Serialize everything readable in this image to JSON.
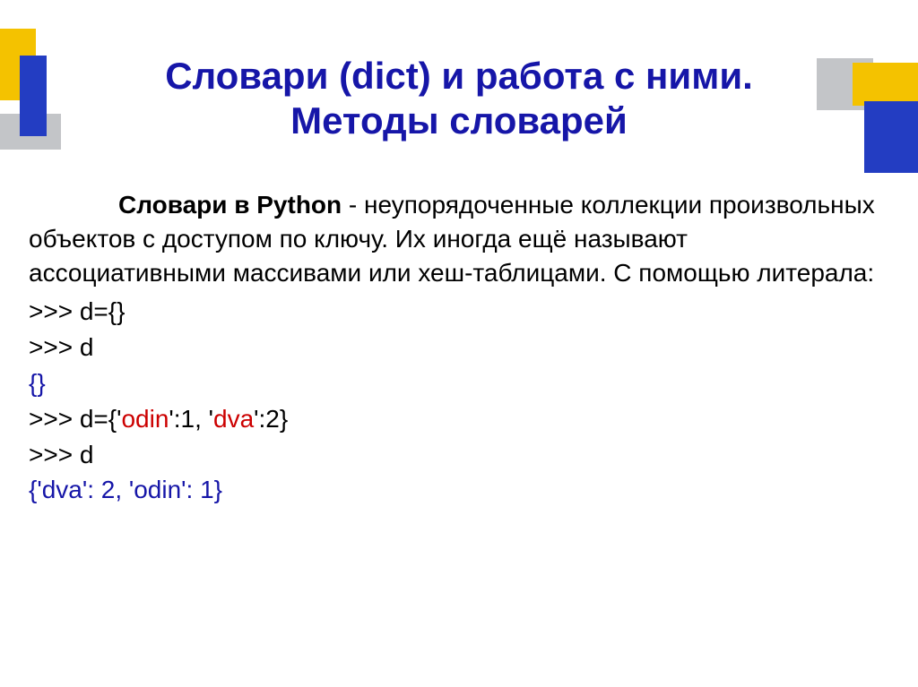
{
  "title": {
    "line1": "Словари (dict) и работа с ними.",
    "line2": "Методы словарей"
  },
  "paragraph": {
    "bold_lead": "Словари в Python",
    "text": " - неупорядоченные коллекции произвольных объектов с доступом по ключу. Их иногда ещё называют ассоциативными массивами или хеш-таблицами. С помощью литерала:"
  },
  "code": {
    "l1": ">>> d={}",
    "l2": ">>> d",
    "l3": "{}",
    "l4a": ">>> d={'",
    "l4_odin": "odin",
    "l4b": "':1, '",
    "l4_dva": "dva",
    "l4c": "':2}",
    "l5": ">>> d",
    "l6": "{'dva': 2, 'odin': 1}"
  }
}
